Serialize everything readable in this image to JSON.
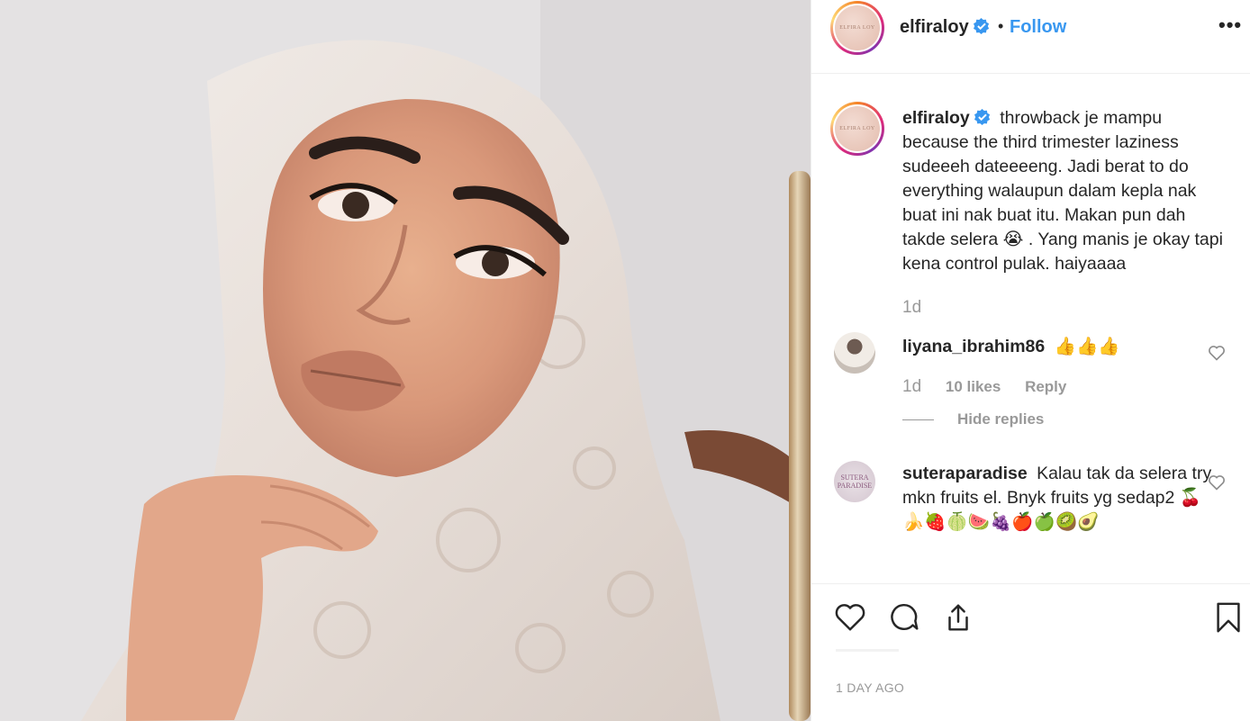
{
  "post": {
    "username": "elfiraloy",
    "dot": "•",
    "follow_label": "Follow",
    "more_label": "•••",
    "avatar_text": "ELFIRA LOY",
    "caption": "throwback je mampu because the third trimester laziness sudeeeh dateeeeng. Jadi berat to do everything walaupun dalam kepla nak buat ini nak buat itu. Makan pun dah takde selera 😭 . Yang manis je okay tapi kena control pulak. haiyaaaa",
    "caption_time": "1d",
    "date": "1 DAY AGO"
  },
  "comments": [
    {
      "username": "liyana_ibrahim86",
      "text": "👍👍👍",
      "time": "1d",
      "likes": "10 likes",
      "reply_label": "Reply",
      "hide_replies_label": "Hide replies"
    },
    {
      "username": "suteraparadise",
      "avatar_text": "SUTERA PARADISE",
      "text": "Kalau tak da selera try mkn fruits el. Bnyk fruits yg sedap2 🍒🍌🍓🍈🍉🍇🍎🍏🥝🥑"
    }
  ],
  "icons": {
    "verified": "verified-badge-icon",
    "like": "heart-icon",
    "comment": "comment-icon",
    "share": "share-icon",
    "save": "bookmark-icon"
  },
  "colors": {
    "link": "#3897f0",
    "verified": "#3897f0",
    "secondary_text": "#999999",
    "text": "#262626"
  }
}
